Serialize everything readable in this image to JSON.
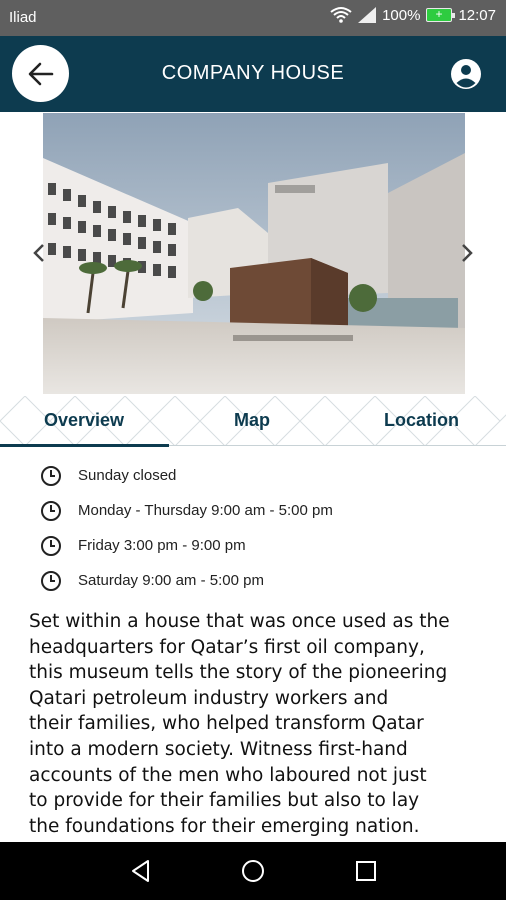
{
  "status_bar": {
    "carrier": "Iliad",
    "battery": "100%",
    "time": "12:07"
  },
  "header": {
    "title": "COMPANY HOUSE",
    "back_icon": "arrow-left-icon",
    "profile_icon": "account-circle-icon"
  },
  "gallery": {
    "image": "museum-building-photo"
  },
  "tabs": [
    {
      "label": "Overview",
      "selected": true
    },
    {
      "label": "Map",
      "selected": false
    },
    {
      "label": "Location",
      "selected": false
    }
  ],
  "hours": [
    "Sunday closed",
    "Monday - Thursday 9:00 am - 5:00 pm",
    "Friday 3:00 pm - 9:00 pm",
    "Saturday 9:00 am - 5:00 pm"
  ],
  "description": [
    "Set within a house that was once used as the",
    "headquarters for Qatar’s first oil company,",
    "this museum tells the story of the pioneering",
    "Qatari petroleum industry workers and",
    "their families, who helped transform Qatar",
    "into a modern society. Witness first-hand",
    "accounts of the men who laboured not just",
    "to provide for their families but also to lay",
    "the foundations for their emerging nation."
  ],
  "colors": {
    "primary": "#0d3b4f",
    "statusbar": "#5f5f5f",
    "battery": "#2ecc40"
  }
}
